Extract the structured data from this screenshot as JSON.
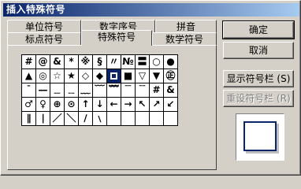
{
  "window": {
    "title": "插入特殊符号"
  },
  "tabs": [
    {
      "label": "单位符号"
    },
    {
      "label": "数字序号"
    },
    {
      "label": "拼音"
    },
    {
      "label": "标点符号"
    },
    {
      "label": "特殊符号"
    },
    {
      "label": "数学符号"
    }
  ],
  "symbols": {
    "rows": [
      [
        "#",
        "@",
        "&",
        "*",
        "※",
        "§",
        "〃",
        "№",
        "〓",
        "○",
        "●"
      ],
      [
        "▲",
        "◎",
        "☆",
        "★",
        "◇",
        "◆",
        "□",
        "■",
        "▽",
        "▼",
        "㊣",
        "△"
      ],
      [
        "ˉ",
        "—",
        "﹍",
        "﹎",
        "﹏",
        "﹋",
        "﹌",
        "﹉",
        "﹊",
        "#",
        "&",
        "*"
      ],
      [
        "♂",
        "♀",
        "⊕",
        "⊙",
        "↑",
        "↓",
        "←",
        "→",
        "↖",
        "↗",
        "↙",
        "↘"
      ],
      [
        "∥",
        "∣",
        "／",
        "＼",
        "∕",
        "﹨",
        "",
        "",
        "",
        "",
        ""
      ]
    ],
    "selected": "□"
  },
  "buttons": {
    "ok": "确定",
    "cancel": "取消",
    "show_toolbar": "显示符号栏 (S)",
    "reset_toolbar": "重设符号栏 (R)"
  }
}
